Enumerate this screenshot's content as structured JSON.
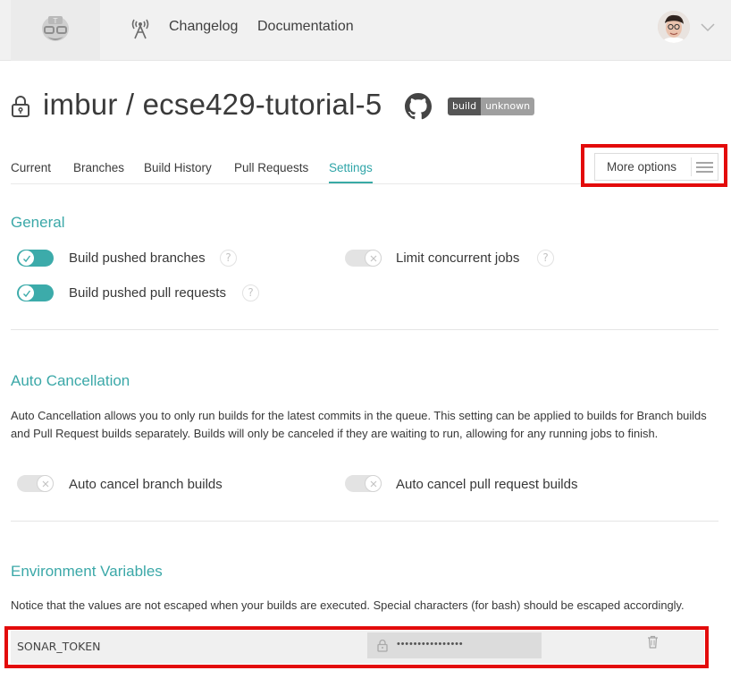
{
  "header": {
    "nav": {
      "changelog": "Changelog",
      "documentation": "Documentation"
    },
    "icons": {
      "logo": "travis-mascot-icon",
      "broadcast": "broadcast-tower-icon",
      "avatar": "user-avatar",
      "chevron": "chevron-down-icon"
    }
  },
  "repo": {
    "title": "imbur / ecse429-tutorial-5",
    "badge": {
      "left": "build",
      "right": "unknown"
    }
  },
  "tabs": [
    {
      "label": "Current"
    },
    {
      "label": "Branches"
    },
    {
      "label": "Build History"
    },
    {
      "label": "Pull Requests"
    },
    {
      "label": "Settings",
      "active": true
    }
  ],
  "more_options": {
    "label": "More options"
  },
  "general": {
    "title": "General",
    "settings": {
      "build_pushed_branches": {
        "label": "Build pushed branches",
        "on": true
      },
      "build_pushed_prs": {
        "label": "Build pushed pull requests",
        "on": true
      },
      "limit_concurrent_jobs": {
        "label": "Limit concurrent jobs",
        "on": false
      }
    },
    "help_glyph": "?"
  },
  "auto_cancellation": {
    "title": "Auto Cancellation",
    "description": "Auto Cancellation allows you to only run builds for the latest commits in the queue. This setting can be applied to builds for Branch builds and Pull Request builds separately. Builds will only be canceled if they are waiting to run, allowing for any running jobs to finish.",
    "branch_builds": {
      "label": "Auto cancel branch builds",
      "on": false
    },
    "pr_builds": {
      "label": "Auto cancel pull request builds",
      "on": false
    }
  },
  "env_vars": {
    "title": "Environment Variables",
    "notice": "Notice that the values are not escaped when your builds are executed. Special characters (for bash) should be escaped accordingly.",
    "rows": [
      {
        "name": "SONAR_TOKEN",
        "masked_value": "••••••••••••••••"
      }
    ]
  },
  "colors": {
    "accent": "#3cabaa",
    "highlight_box": "#e30b0b",
    "toggle_off": "#e3e3e3"
  }
}
